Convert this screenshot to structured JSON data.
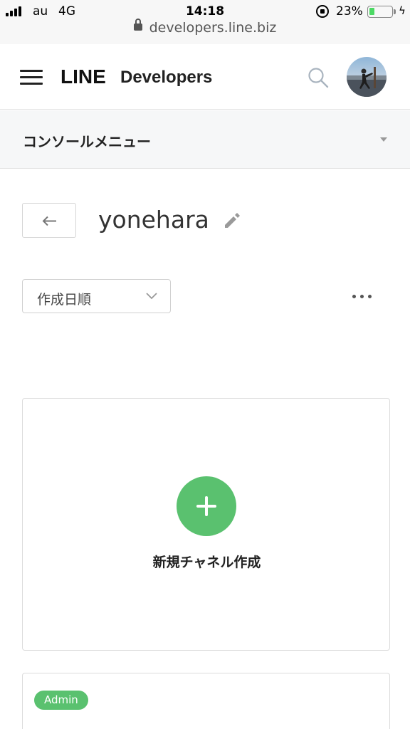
{
  "status_bar": {
    "carrier": "au",
    "network": "4G",
    "time": "14:18",
    "battery_percent": "23%",
    "battery_level": 0.23
  },
  "browser": {
    "url": "developers.line.biz"
  },
  "header": {
    "logo_line": "LINE",
    "logo_developers": "Developers",
    "icons": [
      "menu-icon",
      "search-icon",
      "avatar"
    ]
  },
  "console_menu": {
    "label": "コンソールメニュー"
  },
  "provider": {
    "name": "yonehara"
  },
  "sort": {
    "selected": "作成日順"
  },
  "new_channel": {
    "label": "新規チャネル作成"
  },
  "channel_card": {
    "badge": "Admin"
  },
  "colors": {
    "accent_green": "#5ac16f",
    "menu_bg": "#f6f7f8"
  }
}
